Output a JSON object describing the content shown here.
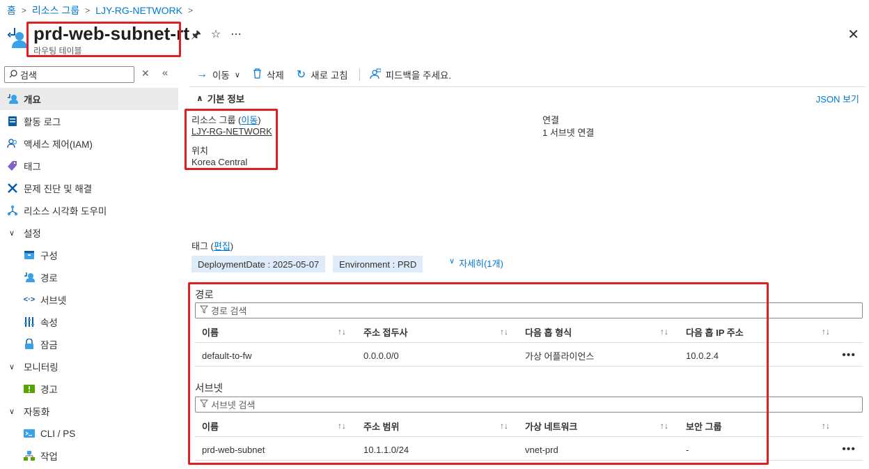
{
  "breadcrumb": [
    "홈",
    "리소스 그룹",
    "LJY-RG-NETWORK"
  ],
  "header": {
    "title": "prd-web-subnet-rt",
    "subtitle": "라우팅 테이블"
  },
  "search": {
    "placeholder": "검색"
  },
  "nav": {
    "overview": "개요",
    "activity_log": "활동 로그",
    "iam": "액세스 제어(IAM)",
    "tags": "태그",
    "diagnose": "문제 진단 및 해결",
    "visualizer": "리소스 시각화 도우미",
    "settings": "설정",
    "configuration": "구성",
    "routes": "경로",
    "subnets": "서브넷",
    "properties": "속성",
    "locks": "잠금",
    "monitoring": "모니터링",
    "alerts": "경고",
    "automation": "자동화",
    "cli_ps": "CLI / PS",
    "tasks": "작업"
  },
  "toolbar": {
    "move": "이동",
    "delete": "삭제",
    "refresh": "새로 고침",
    "feedback": "피드백을 주세요."
  },
  "essentials": {
    "title": "기본 정보",
    "json_view": "JSON 보기",
    "resource_group_label": "리소스 그룹",
    "move_link": "이동",
    "resource_group_value": "LJY-RG-NETWORK",
    "location_label": "위치",
    "location_value": "Korea Central",
    "associations_label": "연결",
    "associations_value": "1 서브넷 연결"
  },
  "tags": {
    "label": "태그",
    "edit_link": "편집",
    "items": [
      "DeploymentDate : 2025-05-07",
      "Environment : PRD"
    ],
    "more": "자세히(1개)"
  },
  "routes": {
    "title": "경로",
    "filter_placeholder": "경로 검색",
    "columns": [
      "이름",
      "주소 접두사",
      "다음 홉 형식",
      "다음 홉 IP 주소"
    ],
    "rows": [
      [
        "default-to-fw",
        "0.0.0.0/0",
        "가상 어플라이언스",
        "10.0.2.4"
      ]
    ]
  },
  "subnets": {
    "title": "서브넷",
    "filter_placeholder": "서브넷 검색",
    "columns": [
      "이름",
      "주소 범위",
      "가상 네트워크",
      "보안 그룹"
    ],
    "rows": [
      [
        "prd-web-subnet",
        "10.1.1.0/24",
        "vnet-prd",
        "-"
      ]
    ]
  },
  "colors": {
    "accent": "#0078d4",
    "highlight_box": "#e02020",
    "tag_bg": "#deecf9"
  }
}
